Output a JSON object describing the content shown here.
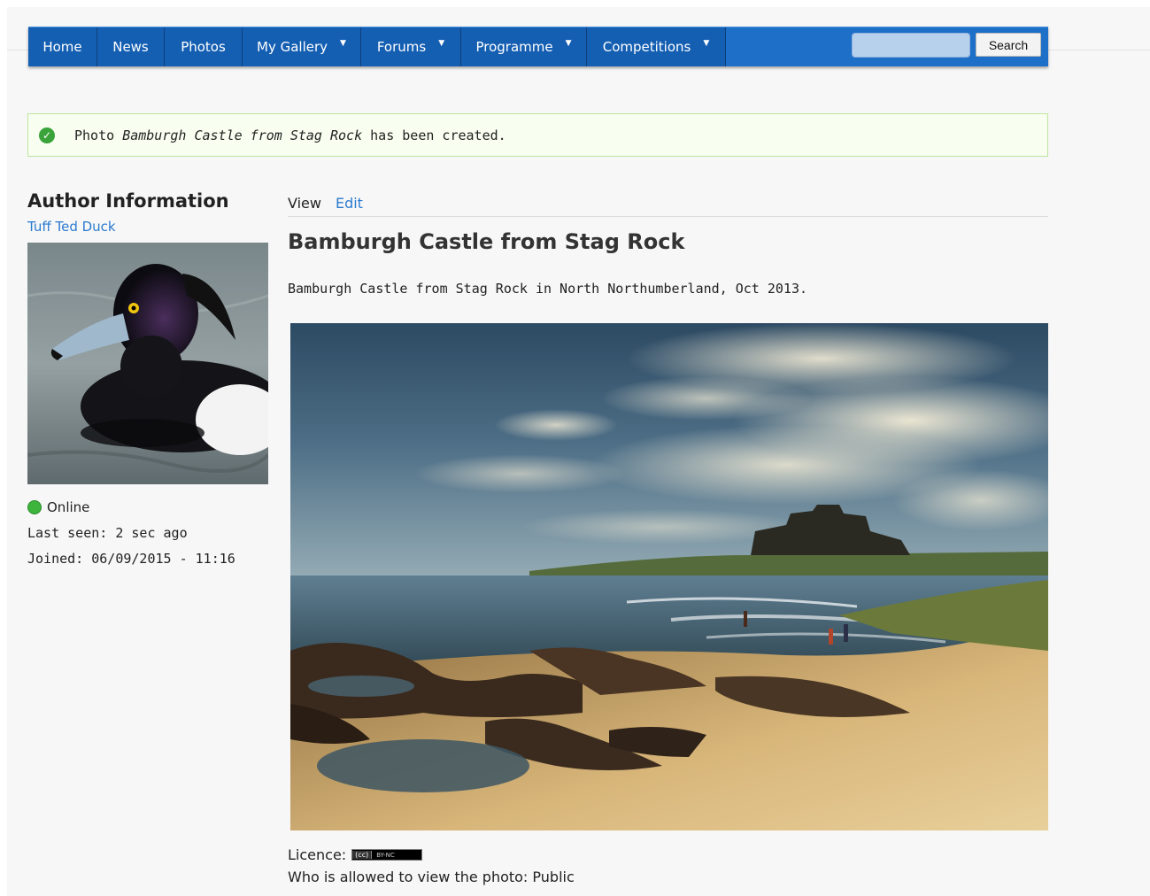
{
  "nav": {
    "items": [
      {
        "label": "Home",
        "dropdown": false
      },
      {
        "label": "News",
        "dropdown": false
      },
      {
        "label": "Photos",
        "dropdown": false
      },
      {
        "label": "My Gallery",
        "dropdown": true
      },
      {
        "label": "Forums",
        "dropdown": true
      },
      {
        "label": "Programme",
        "dropdown": true
      },
      {
        "label": "Competitions",
        "dropdown": true
      }
    ],
    "search_value": "",
    "search_button": "Search",
    "color": "#1e6fc7"
  },
  "status": {
    "prefix": "Photo ",
    "photo_title": "Bamburgh Castle from Stag Rock",
    "suffix": " has been created.",
    "color": "#3aa43a"
  },
  "author": {
    "heading": "Author Information",
    "name": "Tuff Ted Duck",
    "online": "Online",
    "last_seen": "Last seen: 2 sec ago",
    "joined": "Joined: 06/09/2015 - 11:16"
  },
  "tabs": {
    "view": "View",
    "edit": "Edit"
  },
  "photo": {
    "title": "Bamburgh Castle from Stag Rock",
    "description": "Bamburgh Castle from Stag Rock in North Northumberland, Oct 2013.",
    "licence_label": "Licence:",
    "licence_badge_cc": "(cc)",
    "licence_badge_type": "BY-NC",
    "visibility": "Who is allowed to view the photo: Public"
  },
  "link_color": "#2a7bd0"
}
